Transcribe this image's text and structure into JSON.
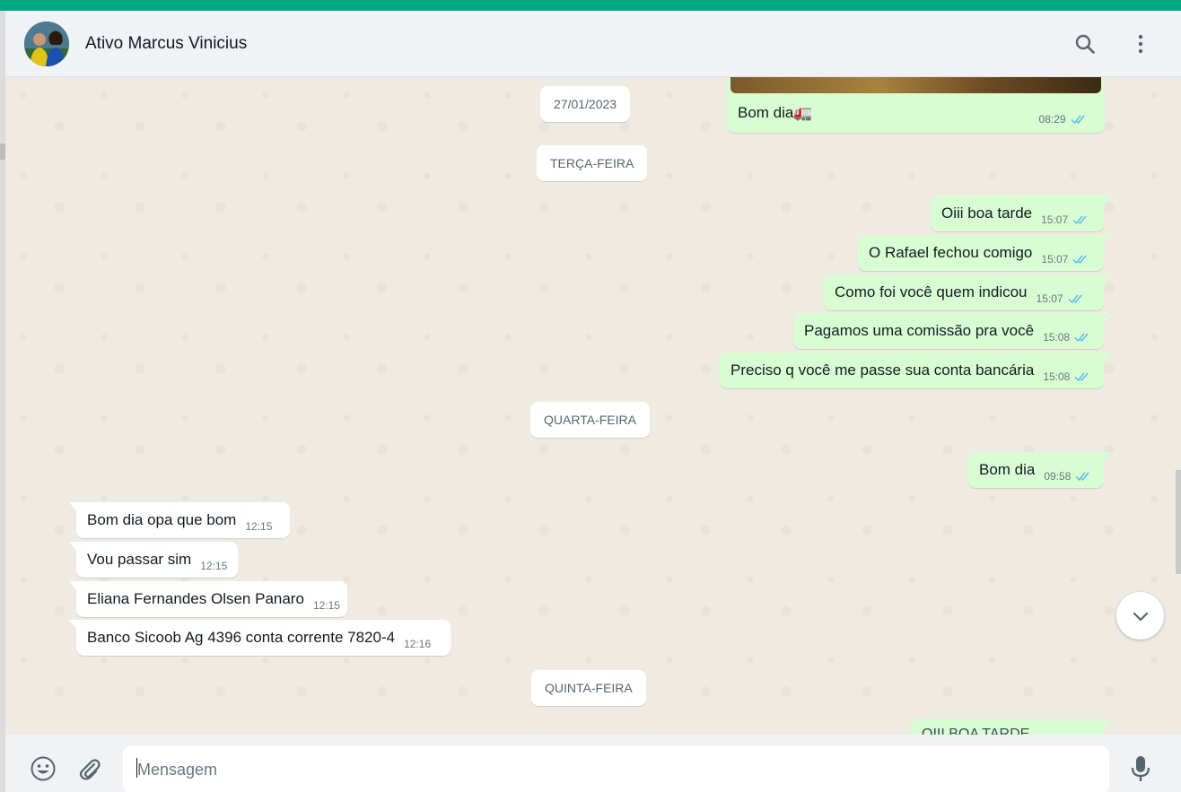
{
  "header": {
    "contact_name": "Ativo Marcus Vinicius",
    "avatar_icon": "contact-avatar",
    "search_icon": "search-icon",
    "menu_icon": "more-vertical-icon"
  },
  "colors": {
    "accent": "#00a884",
    "outgoing_bubble": "#d9fdd3",
    "incoming_bubble": "#ffffff",
    "read_ticks": "#53bdeb"
  },
  "chat": {
    "date_separators": [
      "27/01/2023",
      "TERÇA-FEIRA",
      "QUARTA-FEIRA",
      "QUINTA-FEIRA"
    ],
    "messages": [
      {
        "direction": "out",
        "text": "Bom dia🚛",
        "time": "08:29",
        "status": "read"
      },
      {
        "direction": "out",
        "text": "Oiii boa tarde",
        "time": "15:07",
        "status": "read"
      },
      {
        "direction": "out",
        "text": "O Rafael fechou comigo",
        "time": "15:07",
        "status": "read"
      },
      {
        "direction": "out",
        "text": "Como foi você quem indicou",
        "time": "15:07",
        "status": "read"
      },
      {
        "direction": "out",
        "text": "Pagamos uma comissão pra você",
        "time": "15:08",
        "status": "read"
      },
      {
        "direction": "out",
        "text": "Preciso q você me passe sua conta bancária",
        "time": "15:08",
        "status": "read"
      },
      {
        "direction": "out",
        "text": "Bom dia",
        "time": "09:58",
        "status": "read"
      },
      {
        "direction": "in",
        "text": "Bom dia opa que bom",
        "time": "12:15"
      },
      {
        "direction": "in",
        "text": "Vou passar sim",
        "time": "12:15"
      },
      {
        "direction": "in",
        "text": "Eliana Fernandes Olsen Panaro",
        "time": "12:15"
      },
      {
        "direction": "in",
        "text": "Banco Sicoob Ag 4396 conta corrente 7820-4",
        "time": "12:16"
      },
      {
        "direction": "out",
        "text": "OIII BOA TARDE",
        "time": "",
        "status": "partial"
      }
    ],
    "scroll_down_icon": "chevron-down-icon"
  },
  "composer": {
    "placeholder": "Mensagem",
    "value": "",
    "emoji_icon": "emoji-icon",
    "attach_icon": "paperclip-icon",
    "mic_icon": "microphone-icon"
  }
}
